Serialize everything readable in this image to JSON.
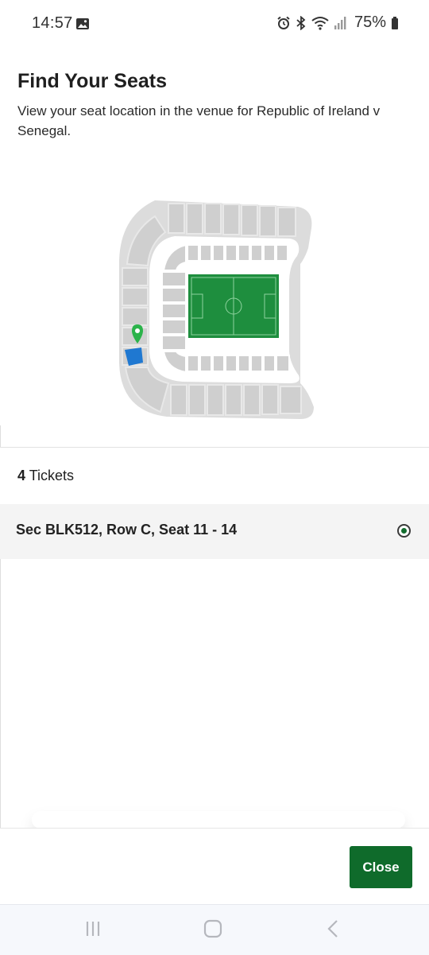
{
  "status_bar": {
    "time": "14:57",
    "battery": "75%",
    "icons": [
      "gallery-icon",
      "alarm-icon",
      "bluetooth-icon",
      "wifi-icon",
      "signal-icon",
      "battery-icon"
    ]
  },
  "header": {
    "title": "Find Your Seats",
    "subtitle": "View your seat location in the venue for Republic of Ireland v Senegal."
  },
  "seat_map": {
    "highlighted_section_color": "#1f78d1",
    "pin_color": "#2bb34a",
    "pitch_color": "#1e8e3e",
    "stand_color": "#cfcfcf"
  },
  "tickets": {
    "count": "4",
    "count_label": "Tickets",
    "items": [
      {
        "label": "Sec BLK512, Row C, Seat 11 - 14",
        "selected": true
      }
    ]
  },
  "footer": {
    "close_label": "Close"
  },
  "nav_bar": {
    "icons": [
      "recent-apps-icon",
      "home-icon",
      "back-icon"
    ]
  },
  "colors": {
    "accent": "#0f6b2b",
    "row_background": "#f4f4f4"
  }
}
